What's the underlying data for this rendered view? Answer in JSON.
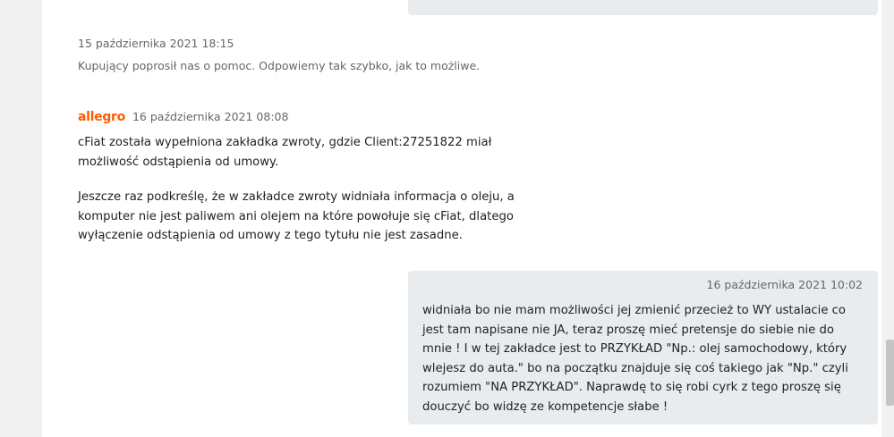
{
  "conversation": {
    "system_event": {
      "timestamp": "15 października 2021 18:15",
      "text": "Kupujący poprosił nas o pomoc. Odpowiemy tak szybko, jak to możliwe."
    },
    "seller_message": {
      "brand": "allegro",
      "timestamp": "16 października 2021 08:08",
      "paragraphs": [
        "cFiat została wypełniona zakładka zwroty, gdzie Client:27251822 miał możliwość odstąpienia od umowy.",
        "Jeszcze raz podkreślę, że w zakładce zwroty widniała informacja o oleju, a komputer nie jest paliwem ani olejem na które powołuje się cFiat, dlatego wyłączenie odstąpienia od umowy z tego tytułu nie jest zasadne."
      ]
    },
    "my_message": {
      "timestamp": "16 października 2021 10:02",
      "text": "widniała bo nie mam możliwości jej zmienić przecież to WY ustalacie co jest tam napisane nie JA, teraz proszę mieć pretensje do siebie nie do mnie ! I w tej zakładce jest to PRZYKŁAD \"Np.: olej samochodowy, który wlejesz do auta.\" bo na początku znajduje się coś takiego jak \"Np.\" czyli rozumiem \"NA PRZYKŁAD\". Naprawdę to się robi cyrk z tego proszę się douczyć bo widzę ze kompetencje słabe !"
    }
  },
  "colors": {
    "brand": "#ff5a00",
    "bubble": "#e9ecef",
    "muted_text": "#666666"
  }
}
